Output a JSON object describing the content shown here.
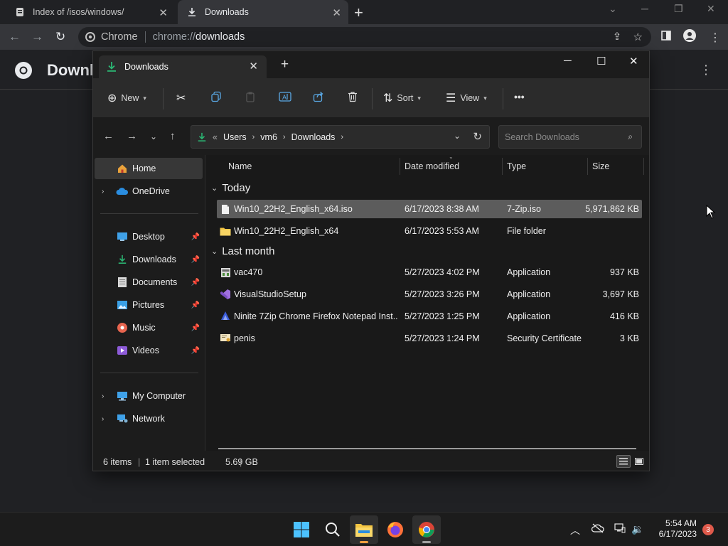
{
  "chrome": {
    "tabs": [
      {
        "title": "Index of /isos/windows/",
        "active": false
      },
      {
        "title": "Downloads",
        "active": true
      }
    ],
    "omnibox": {
      "site_chip": "Chrome",
      "url_scheme": "chrome://",
      "url_host": "downloads"
    },
    "page": {
      "title": "Downl"
    }
  },
  "explorer": {
    "tab_title": "Downloads",
    "commandbar": {
      "new_label": "New",
      "sort_label": "Sort",
      "view_label": "View",
      "more_label": "•••"
    },
    "address": {
      "prefix": "«",
      "segments": [
        "Users",
        "vm6",
        "Downloads"
      ]
    },
    "search_placeholder": "Search Downloads",
    "nav": {
      "home": "Home",
      "onedrive": "OneDrive",
      "pinned": [
        "Desktop",
        "Downloads",
        "Documents",
        "Pictures",
        "Music",
        "Videos"
      ],
      "my_computer": "My Computer",
      "network": "Network"
    },
    "columns": {
      "name": "Name",
      "date": "Date modified",
      "type": "Type",
      "size": "Size"
    },
    "groups": [
      {
        "label": "Today",
        "files": [
          {
            "name": "Win10_22H2_English_x64.iso",
            "date": "6/17/2023 8:38 AM",
            "type": "7-Zip.iso",
            "size": "5,971,862 KB",
            "icon": "iso-file-icon",
            "selected": true
          },
          {
            "name": "Win10_22H2_English_x64",
            "date": "6/17/2023 5:53 AM",
            "type": "File folder",
            "size": "",
            "icon": "folder-icon",
            "selected": false
          }
        ]
      },
      {
        "label": "Last month",
        "files": [
          {
            "name": "vac470",
            "date": "5/27/2023 4:02 PM",
            "type": "Application",
            "size": "937 KB",
            "icon": "application-icon"
          },
          {
            "name": "VisualStudioSetup",
            "date": "5/27/2023 3:26 PM",
            "type": "Application",
            "size": "3,697 KB",
            "icon": "visual-studio-icon"
          },
          {
            "name": "Ninite 7Zip Chrome Firefox Notepad Inst...",
            "date": "5/27/2023 1:25 PM",
            "type": "Application",
            "size": "416 KB",
            "icon": "ninite-icon"
          },
          {
            "name": "penis",
            "date": "5/27/2023 1:24 PM",
            "type": "Security Certificate",
            "size": "3 KB",
            "icon": "certificate-icon"
          }
        ]
      }
    ],
    "status": {
      "items": "6 items",
      "selected": "1 item selected",
      "selected_size": "5.69 GB"
    }
  },
  "taskbar": {
    "time": "5:54 AM",
    "date": "6/17/2023",
    "notification_count": "3"
  },
  "colors": {
    "accent_green": "#2bb673",
    "folder_yellow": "#f4c542",
    "selection": "#5c5c5c",
    "notif_red": "#e05a4b"
  }
}
